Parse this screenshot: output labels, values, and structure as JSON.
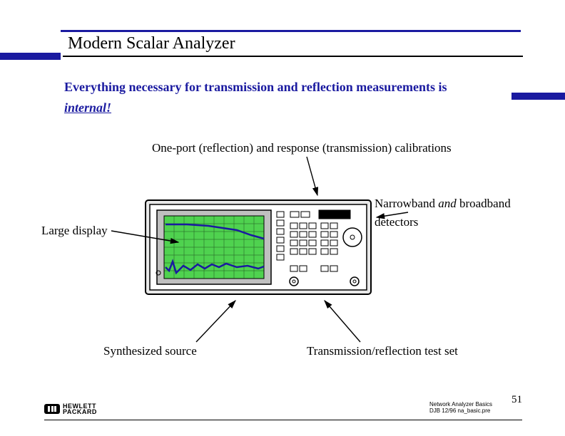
{
  "title": "Modern Scalar Analyzer",
  "subtitle_line1": "Everything necessary for transmission and reflection measurements is",
  "subtitle_internal": "internal!",
  "labels": {
    "calibrations": "One-port (reflection) and response (transmission) calibrations",
    "narrowband_pre": "Narrowband ",
    "narrowband_ital": "and ",
    "narrowband_post": "broadband",
    "detectors": "detectors",
    "large_display": "Large display",
    "synth_source": "Synthesized source",
    "test_set": "Transmission/reflection test set"
  },
  "footer": {
    "brand_top": "HEWLETT",
    "brand_bottom": "PACKARD",
    "line1": "Network Analyzer Basics",
    "line2": "DJB   12/96   na_basic.pre",
    "page": "51"
  }
}
